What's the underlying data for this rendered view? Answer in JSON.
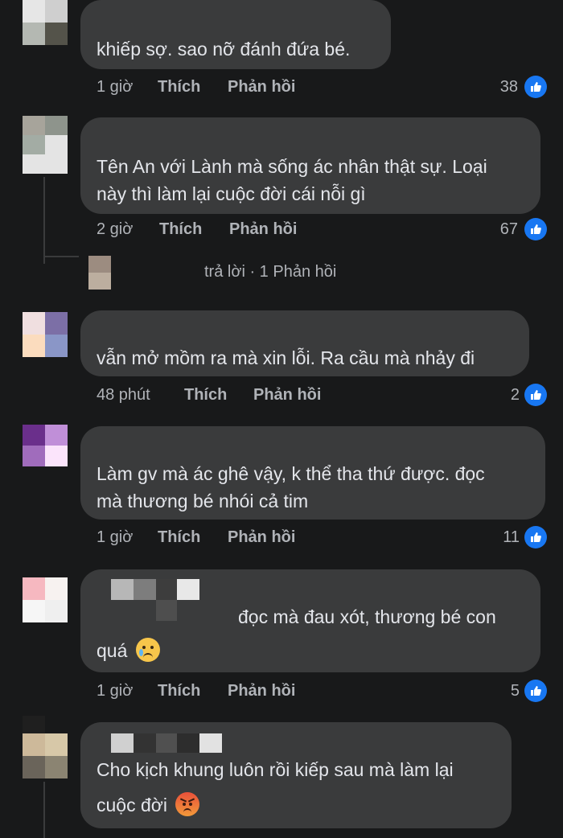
{
  "like_accent": "#1877f2",
  "comments": [
    {
      "lines": [
        "khiếp sợ. sao nỡ đánh đứa bé."
      ],
      "time": "1 giờ",
      "like": "Thích",
      "reply": "Phản hồi",
      "count": "38",
      "avatar_colors": [
        "#e6e6e6",
        "#cfcfcf",
        "#b4b8b2",
        "#54534a"
      ]
    },
    {
      "lines": [
        "Tên An với Lành mà sống ác nhân thật sự. Loại",
        "này thì làm lại cuộc đời cái nỗi gì"
      ],
      "time": "2 giờ",
      "like": "Thích",
      "reply": "Phản hồi",
      "count": "67",
      "avatar_colors": [
        "#a7a49b",
        "#8e948c",
        "#a3aca4",
        "#e4e4e4"
      ],
      "reply_summary": "trả lời · 1 Phản hồi",
      "reply_avatar_colors": [
        "#9c8c80",
        "#bcae9f"
      ]
    },
    {
      "lines": [
        "vẫn mở mồm ra mà xin lỗi. Ra cầu mà nhảy đi"
      ],
      "time": "48 phút",
      "like": "Thích",
      "reply": "Phản hồi",
      "count": "2",
      "avatar_colors": [
        "#f0dfe0",
        "#7c6fa6",
        "#fbdcbe",
        "#8a96c7"
      ]
    },
    {
      "lines": [
        "Làm gv mà ác ghê vậy, k thể tha thứ được. đọc",
        "mà thương bé nhói cả tim"
      ],
      "time": "1 giờ",
      "like": "Thích",
      "reply": "Phản hồi",
      "count": "11",
      "avatar_colors": [
        "#6a2f8b",
        "#c08fd8",
        "#a06cbc",
        "#fbe4fb"
      ]
    },
    {
      "lines": [
        "đọc mà đau xót, thương bé con",
        "quá"
      ],
      "emoji": "crying-face",
      "time": "1 giờ",
      "like": "Thích",
      "reply": "Phản hồi",
      "count": "5",
      "avatar_colors": [
        "#f6b8c0",
        "#f7f2f0",
        "#f6f6f6",
        "#efefef"
      ]
    },
    {
      "lines": [
        "Cho kịch khung luôn rồi kiếp sau mà làm lại",
        "cuộc đời"
      ],
      "emoji": "angry-face",
      "avatar_colors": [
        "#cdb99a",
        "#d7c8a8",
        "#6a645a",
        "#8b8472"
      ]
    }
  ]
}
